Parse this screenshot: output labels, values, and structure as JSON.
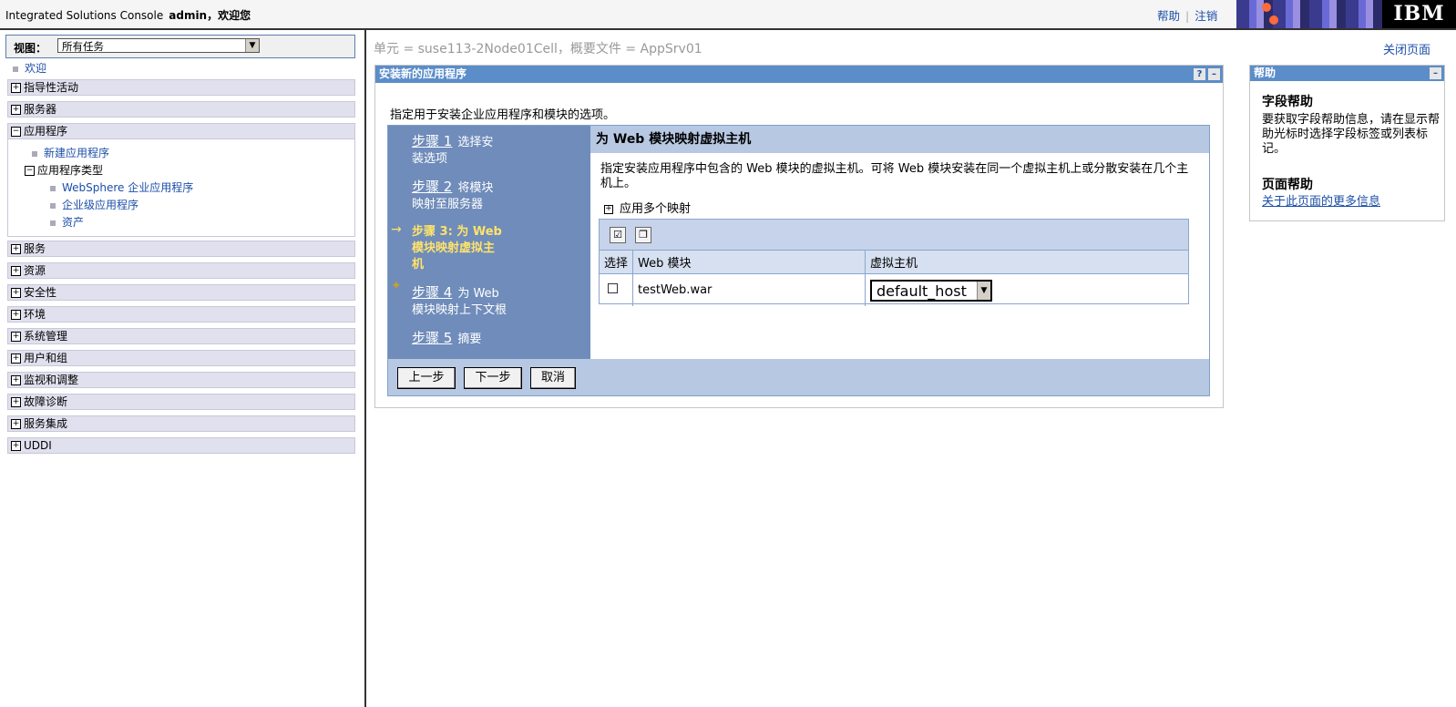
{
  "banner": {
    "app_title": "Integrated Solutions Console",
    "welcome": "admin，欢迎您",
    "help_link": "帮助",
    "separator": "|",
    "logout_link": "注销",
    "logo": "IBM"
  },
  "nav": {
    "view_label": "视图：",
    "view_value": "所有任务",
    "welcome": "欢迎",
    "categories": [
      {
        "label": "指导性活动",
        "expanded": false
      },
      {
        "label": "服务器",
        "expanded": false
      },
      {
        "label": "应用程序",
        "expanded": true
      },
      {
        "label": "服务",
        "expanded": false
      },
      {
        "label": "资源",
        "expanded": false
      },
      {
        "label": "安全性",
        "expanded": false
      },
      {
        "label": "环境",
        "expanded": false
      },
      {
        "label": "系统管理",
        "expanded": false
      },
      {
        "label": "用户和组",
        "expanded": false
      },
      {
        "label": "监视和调整",
        "expanded": false
      },
      {
        "label": "故障诊断",
        "expanded": false
      },
      {
        "label": "服务集成",
        "expanded": false
      },
      {
        "label": "UDDI",
        "expanded": false
      }
    ],
    "app_children": {
      "new_app": "新建应用程序",
      "app_types": "应用程序类型",
      "websphere_apps": "WebSphere 企业应用程序",
      "enterprise_apps": "企业级应用程序",
      "assets": "资产"
    }
  },
  "main": {
    "breadcrumb": "单元 = suse113-2Node01Cell，概要文件 = AppSrv01",
    "close_page": "关闭页面",
    "panel_title": "安装新的应用程序",
    "help_q": "?",
    "minimize": "–",
    "intro": "指定用于安装企业应用程序和模块的选项。",
    "steps": [
      {
        "num": "步骤 1",
        "label": "选择安",
        "label2": "装选项"
      },
      {
        "num": "步骤 2",
        "label": "将模块",
        "label2": "映射至服务器"
      },
      {
        "num": "步骤 3: 为 Web",
        "label2": "模块映射虚拟主",
        "label3": "机"
      },
      {
        "num": "步骤 4",
        "label": "为 Web",
        "label2": "模块映射上下文根"
      },
      {
        "num": "步骤 5",
        "label": "摘要"
      }
    ],
    "current_marker": "→",
    "next_marker": "✦",
    "content_title": "为 Web 模块映射虚拟主机",
    "description": "指定安装应用程序中包含的 Web 模块的虚拟主机。可将 Web 模块安装在同一个虚拟主机上或分散安装在几个主机上。",
    "apply_multiple": "应用多个映射",
    "table": {
      "headers": [
        "选择",
        "Web 模块",
        "虚拟主机"
      ],
      "rows": [
        {
          "module": "testWeb.war",
          "host": "default_host",
          "selected": false
        }
      ]
    },
    "buttons": {
      "prev": "上一步",
      "next": "下一步",
      "cancel": "取消"
    }
  },
  "help": {
    "title": "帮助",
    "field_help_title": "字段帮助",
    "field_help_text": "要获取字段帮助信息，请在显示帮助光标时选择字段标签或列表标记。",
    "page_help_title": "页面帮助",
    "page_help_link": "关于此页面的更多信息"
  }
}
